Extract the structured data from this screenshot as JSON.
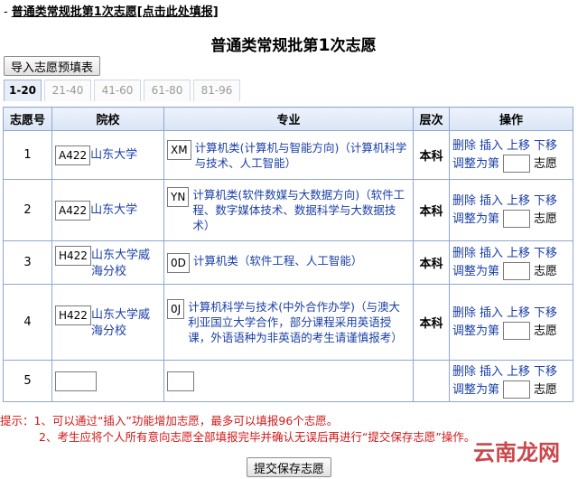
{
  "header": {
    "dash": "-",
    "link_text": "普通类常规批第1次志愿[点击此处填报]"
  },
  "page_title": {
    "prefix": "普通类常规批第",
    "num": "1",
    "suffix": "次志愿"
  },
  "import_button": "导入志愿预填表",
  "tabs": [
    "1-20",
    "21-40",
    "41-60",
    "61-80",
    "81-96"
  ],
  "columns": [
    "志愿号",
    "院校",
    "专业",
    "层次",
    "操作"
  ],
  "rows": [
    {
      "no": "1",
      "school_code": "A422",
      "school": "山东大学",
      "major_code": "XM",
      "major": "计算机类(计算机与智能方向)（计算机科学与技术、人工智能）",
      "level": "本科"
    },
    {
      "no": "2",
      "school_code": "A422",
      "school": "山东大学",
      "major_code": "YN",
      "major": "计算机类(软件数媒与大数据方向)（软件工程、数字媒体技术、数据科学与大数据技术）",
      "level": "本科"
    },
    {
      "no": "3",
      "school_code": "H422",
      "school": "山东大学威海分校",
      "major_code": "0D",
      "major": "计算机类（软件工程、人工智能）",
      "level": "本科"
    },
    {
      "no": "4",
      "school_code": "H422",
      "school": "山东大学威海分校",
      "major_code": "0J",
      "major": "计算机科学与技术(中外合作办学)（与澳大利亚国立大学合作，部分课程采用英语授课，外语语种为非英语的考生请谨慎报考）",
      "level": "本科"
    },
    {
      "no": "5",
      "school_code": "",
      "school": "",
      "major_code": "",
      "major": "",
      "level": ""
    }
  ],
  "ops": {
    "delete": "删除",
    "insert": "插入",
    "up": "上移",
    "down": "下移",
    "adjust_prefix": "调整为第",
    "adjust_suffix": "志愿"
  },
  "tips": {
    "line1": "提示：1、可以通过“插入”功能增加志愿，最多可以填报96个志愿。",
    "line2": "2、考生应将个人所有意向志愿全部填报完毕并确认无误后再进行“提交保存志愿”操作。"
  },
  "submit_button": "提交保存志愿",
  "watermark": "云南龙网",
  "colors": {
    "link_blue": "#1a3fa8",
    "tip_red": "#d01818",
    "border_blue": "#8fa7cf"
  }
}
